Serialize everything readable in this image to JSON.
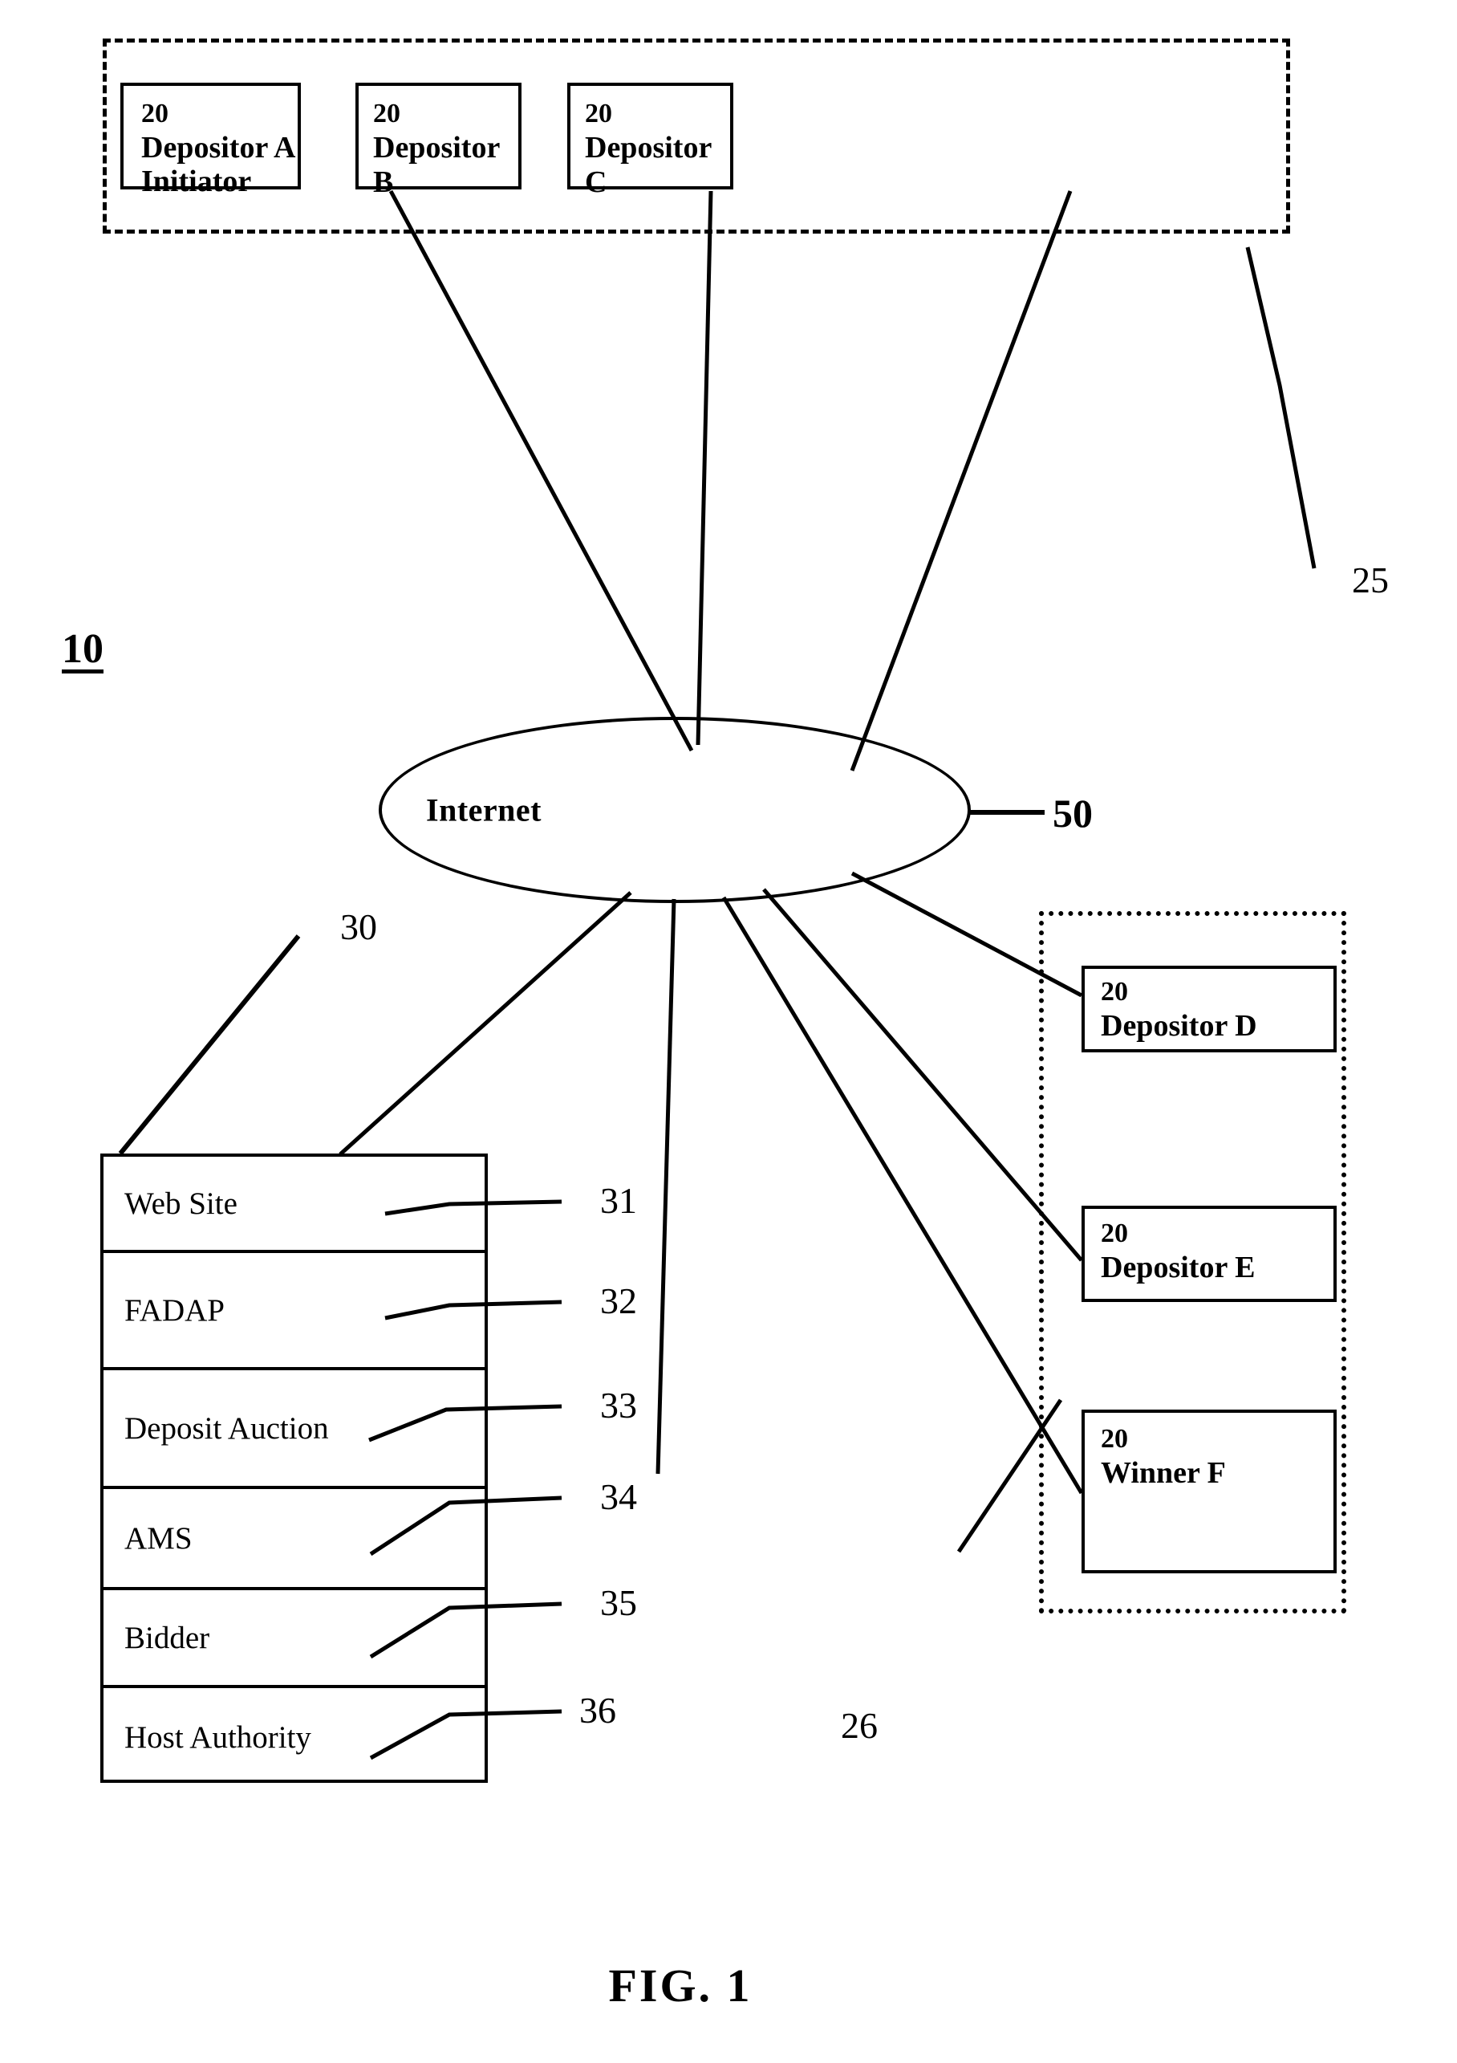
{
  "figure": {
    "caption": "FIG. 1",
    "system_ref": "10"
  },
  "groups": {
    "initiator_group": {
      "ref": "25",
      "style": "dashed"
    },
    "bidder_group": {
      "ref": "26",
      "style": "dotted"
    }
  },
  "network": {
    "label": "Internet",
    "ref": "50"
  },
  "depositors_top": [
    {
      "num": "20",
      "line1": "Depositor A",
      "line2": "Initiator"
    },
    {
      "num": "20",
      "line1": "Depositor B",
      "line2": ""
    },
    {
      "num": "20",
      "line1": "Depositor C",
      "line2": ""
    }
  ],
  "depositors_right": [
    {
      "num": "20",
      "line1": "Depositor D",
      "line2": ""
    },
    {
      "num": "20",
      "line1": "Depositor E",
      "line2": ""
    },
    {
      "num": "20",
      "line1": "Winner F",
      "line2": ""
    }
  ],
  "server": {
    "ref": "30",
    "rows": [
      {
        "label": "Web Site",
        "ref": "31"
      },
      {
        "label": "FADAP",
        "ref": "32"
      },
      {
        "label": "Deposit Auction",
        "ref": "33"
      },
      {
        "label": "AMS",
        "ref": "34"
      },
      {
        "label": "Bidder",
        "ref": "35"
      },
      {
        "label": "Host Authority",
        "ref": "36"
      }
    ]
  }
}
